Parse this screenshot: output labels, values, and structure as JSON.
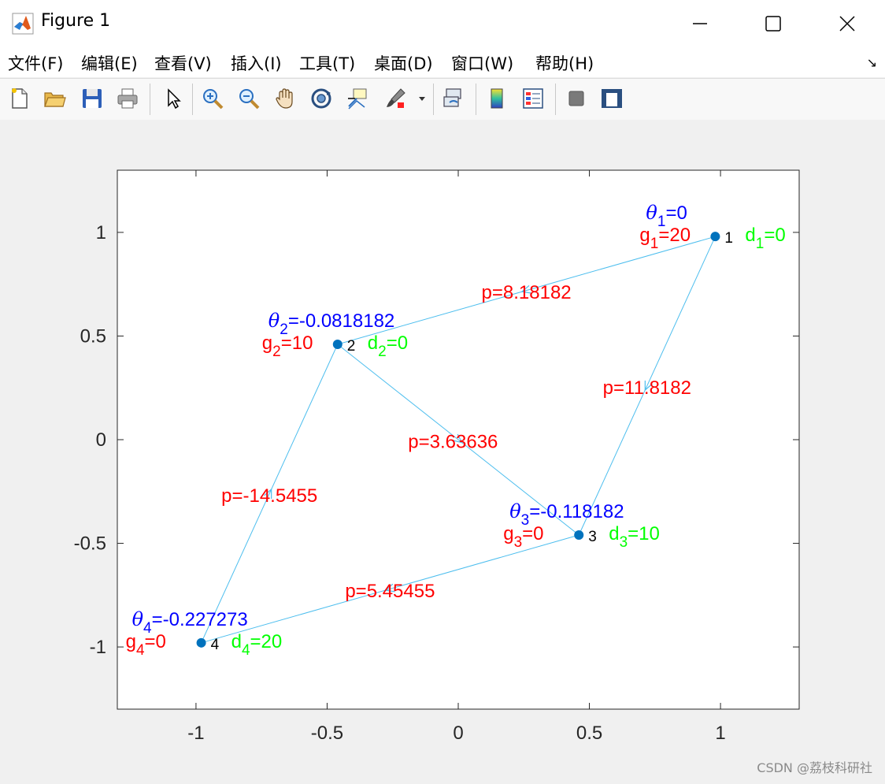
{
  "window": {
    "title": "Figure 1",
    "controls": [
      "minimize",
      "maximize",
      "close"
    ]
  },
  "menu": {
    "items": [
      {
        "label": "文件(F)"
      },
      {
        "label": "编辑(E)"
      },
      {
        "label": "查看(V)"
      },
      {
        "label": "插入(I)"
      },
      {
        "label": "工具(T)"
      },
      {
        "label": "桌面(D)"
      },
      {
        "label": "窗口(W)"
      },
      {
        "label": "帮助(H)"
      }
    ]
  },
  "toolbar": {
    "buttons": [
      {
        "name": "new-figure-button",
        "icon": "new-file-icon"
      },
      {
        "name": "open-file-button",
        "icon": "folder-open-icon"
      },
      {
        "name": "save-figure-button",
        "icon": "save-icon"
      },
      {
        "name": "print-figure-button",
        "icon": "printer-icon"
      },
      {
        "name": "edit-plot-button",
        "icon": "arrow-cursor-icon"
      },
      {
        "name": "zoom-in-button",
        "icon": "zoom-in-icon"
      },
      {
        "name": "zoom-out-button",
        "icon": "zoom-out-icon"
      },
      {
        "name": "pan-button",
        "icon": "hand-icon"
      },
      {
        "name": "rotate-3d-button",
        "icon": "rotate-icon"
      },
      {
        "name": "data-cursor-button",
        "icon": "data-cursor-icon"
      },
      {
        "name": "brush-button",
        "icon": "brush-icon"
      },
      {
        "name": "link-plot-button",
        "icon": "link-plot-icon"
      },
      {
        "name": "insert-colorbar-button",
        "icon": "colorbar-icon"
      },
      {
        "name": "insert-legend-button",
        "icon": "legend-icon"
      },
      {
        "name": "hide-plot-tools-button",
        "icon": "hide-tools-icon"
      },
      {
        "name": "show-plot-tools-button",
        "icon": "show-tools-icon"
      }
    ]
  },
  "colors": {
    "node": "#0072bd",
    "edge": "#4dbeee",
    "theta": "#0000ff",
    "g": "#ff0000",
    "d": "#00ff00",
    "p": "#ff0000"
  },
  "chart_data": {
    "type": "scatter",
    "title": "",
    "xlabel": "",
    "ylabel": "",
    "xlim": [
      -1.3,
      1.3
    ],
    "ylim": [
      -1.3,
      1.3
    ],
    "x_ticks": [
      "-1",
      "-0.5",
      "0",
      "0.5",
      "1"
    ],
    "y_ticks": [
      "1",
      "0.5",
      "0",
      "-0.5",
      "-1"
    ],
    "x_tick_values": [
      -1,
      -0.5,
      0,
      0.5,
      1
    ],
    "y_tick_values": [
      1,
      0.5,
      0,
      -0.5,
      -1
    ],
    "grid": false,
    "nodes": [
      {
        "id": "1",
        "x": 0.98,
        "y": 0.98,
        "theta": "=0",
        "g": "=20",
        "d": "=0"
      },
      {
        "id": "2",
        "x": -0.46,
        "y": 0.46,
        "theta": "=-0.0818182",
        "g": "=10",
        "d": "=0"
      },
      {
        "id": "3",
        "x": 0.46,
        "y": -0.46,
        "theta": "=-0.118182",
        "g": "=0",
        "d": "=10"
      },
      {
        "id": "4",
        "x": -0.98,
        "y": -0.98,
        "theta": "=-0.227273",
        "g": "=0",
        "d": "=20"
      }
    ],
    "edges": [
      {
        "from": "1",
        "to": "2",
        "label": "p=8.18182",
        "lx": 0.26,
        "ly": 0.71
      },
      {
        "from": "1",
        "to": "3",
        "label": "p=11.8182",
        "lx": 0.72,
        "ly": 0.25
      },
      {
        "from": "2",
        "to": "3",
        "label": "p=3.63636",
        "lx": -0.02,
        "ly": -0.01
      },
      {
        "from": "3",
        "to": "4",
        "label": "p=5.45455",
        "lx": -0.26,
        "ly": -0.73
      },
      {
        "from": "4",
        "to": "2",
        "label": "p=-14.5455",
        "lx": -0.72,
        "ly": -0.27
      }
    ]
  },
  "watermark": "CSDN @荔枝科研社"
}
